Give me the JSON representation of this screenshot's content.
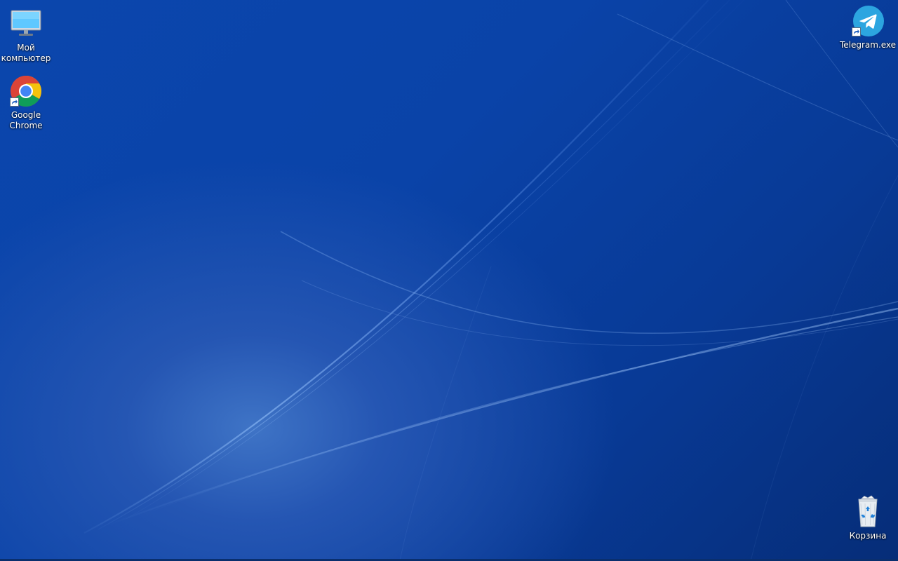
{
  "desktop": {
    "icons": [
      {
        "label": "Мой\nкомпьютер",
        "icon": "monitor-icon",
        "shortcut": false
      },
      {
        "label": "Google\nChrome",
        "icon": "chrome-icon",
        "shortcut": true
      },
      {
        "label": "Telegram.exe",
        "icon": "telegram-icon",
        "shortcut": true
      },
      {
        "label": "Корзина",
        "icon": "recycle-bin-icon",
        "shortcut": false
      }
    ]
  },
  "colors": {
    "wallpaper_primary": "#0b46ad",
    "wallpaper_dark": "#062d78",
    "light_streak": "#6fa3ff",
    "chrome_red": "#db4437",
    "chrome_yellow": "#f4c20d",
    "chrome_green": "#0f9d58",
    "chrome_blue": "#4285f4",
    "telegram_blue": "#2ca5e0"
  }
}
